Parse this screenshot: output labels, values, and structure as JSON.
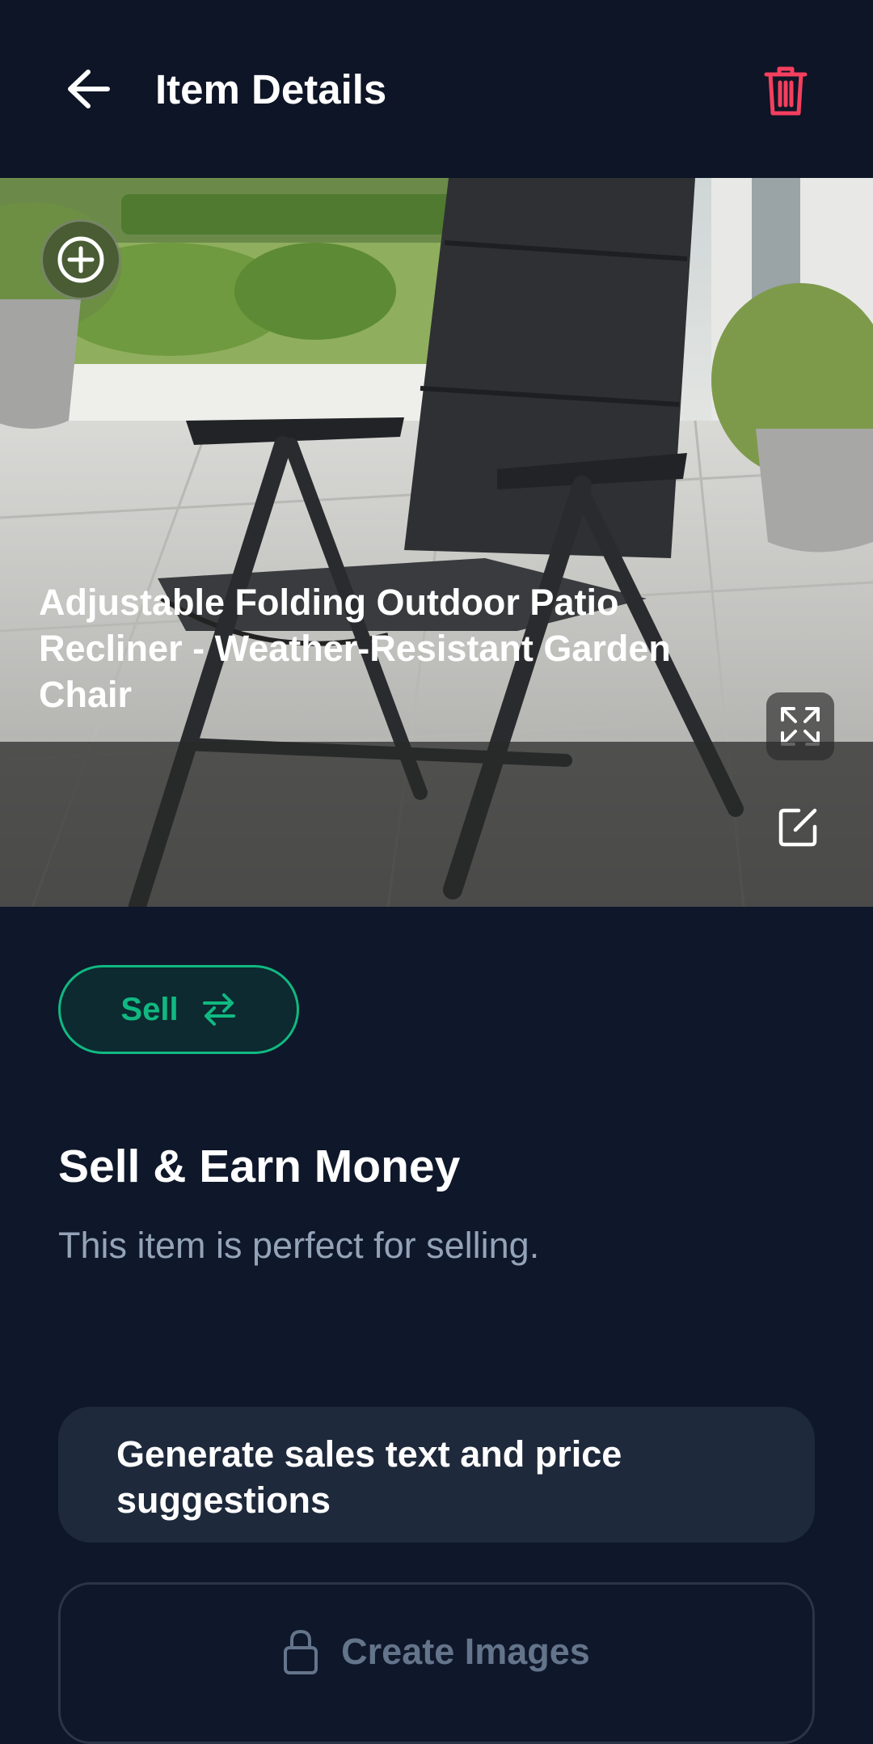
{
  "header": {
    "title": "Item Details",
    "back_icon": "arrow-left-icon",
    "delete_icon": "trash-icon",
    "delete_color": "#f43f5e"
  },
  "item": {
    "title": "Adjustable Folding Outdoor Patio Recliner - Weather-Resistant Garden Chair",
    "image_subject": "black folding patio recliner chair on a stone terrace",
    "add_photo_icon": "plus-circle-icon",
    "expand_icon": "expand-icon",
    "edit_icon": "edit-icon"
  },
  "mode": {
    "label": "Sell",
    "icon": "swap-arrows-icon",
    "accent": "#10b981"
  },
  "section": {
    "title": "Sell & Earn Money",
    "description": "This item is perfect for selling."
  },
  "actions": {
    "generate_label": "Generate sales text and price suggestions",
    "create_images_label": "Create Images",
    "create_images_icon": "lock-icon"
  },
  "colors": {
    "background": "#0f172a",
    "card": "#1e293b",
    "muted_text": "#94a3b8"
  }
}
